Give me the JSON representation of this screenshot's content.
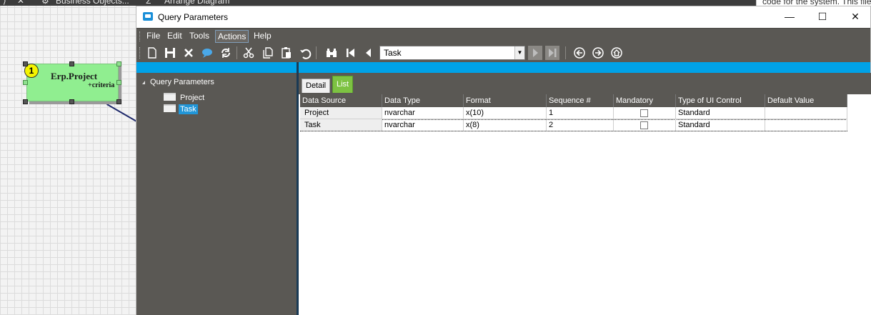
{
  "background": {
    "tab1": "Business Objects...",
    "tab2": "Arrange Diagram",
    "right_text": "code for the system. This file g",
    "entity": {
      "badge": "1",
      "name": "Erp.Project",
      "attribute": "+criteria"
    }
  },
  "window": {
    "title": "Query Parameters",
    "controls": {
      "minimize": "—",
      "maximize": "☐",
      "close": "✕"
    }
  },
  "menu": [
    "File",
    "Edit",
    "Tools",
    "Actions",
    "Help"
  ],
  "menu_active": "Actions",
  "toolbar": {
    "icons": [
      "new-icon",
      "save-icon",
      "delete-icon",
      "comment-icon",
      "refresh-icon",
      "cut-icon",
      "copy-icon",
      "paste-icon",
      "undo-icon",
      "search-icon",
      "first-record-icon",
      "previous-record-icon",
      "next-record-icon",
      "last-record-icon",
      "back-icon",
      "forward-icon",
      "home-icon"
    ],
    "combo_value": "Task"
  },
  "tree": {
    "root": "Query Parameters",
    "children": [
      {
        "label": "Project",
        "selected": false
      },
      {
        "label": "Task",
        "selected": true
      }
    ]
  },
  "tabs": [
    {
      "label": "Detail",
      "active": false
    },
    {
      "label": "List",
      "active": true
    }
  ],
  "grid": {
    "columns": [
      "Data Source",
      "Data Type",
      "Format",
      "Sequence #",
      "Mandatory",
      "Type of UI Control",
      "Default Value"
    ],
    "rows": [
      [
        "Project",
        "nvarchar",
        "x(10)",
        "1",
        "",
        "Standard",
        ""
      ],
      [
        "Task",
        "nvarchar",
        "x(8)",
        "2",
        "",
        "Standard",
        ""
      ]
    ]
  },
  "colors": {
    "accent_blue": "#00a2e8",
    "pane_gray": "#5a5854",
    "tab_active_green": "#7dc242",
    "tree_selection": "#2196d8",
    "entity_green": "#90ee90"
  }
}
